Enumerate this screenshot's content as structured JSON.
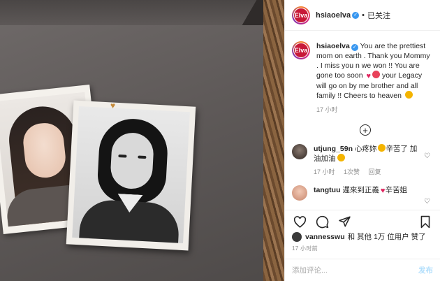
{
  "header": {
    "username": "hsiaoelva",
    "separator": "•",
    "follow_status": "已关注",
    "avatar_text": "Elva"
  },
  "caption": {
    "username": "hsiaoelva",
    "text_part1": "You are the prettiest mom on earth . Thank you Mommy . I miss you n we won !! You are gone too soon",
    "text_part2": "your Legacy will go on by me brother and all family !! Cheers to heaven",
    "time": "17 小时"
  },
  "comments": [
    {
      "username": "utjung_59n",
      "text_part1": "心疼妳",
      "text_part2": "辛苦了 加油加油",
      "time": "17 小时",
      "likes": "1次赞",
      "reply": "回复"
    },
    {
      "username": "tangtuu",
      "text": "遲來到正義",
      "text_part2": "辛苦姐"
    }
  ],
  "actions": {
    "liked_by_user": "vannesswu",
    "liked_by_rest": "和 其他 1万 位用户 赞了",
    "post_time": "17 小时前"
  },
  "add_comment": {
    "placeholder": "添加评论...",
    "post_label": "发布"
  },
  "colors": {
    "accent": "#3897f0",
    "post_button_disabled": "#b2dffc",
    "heart": "#e0245e"
  }
}
